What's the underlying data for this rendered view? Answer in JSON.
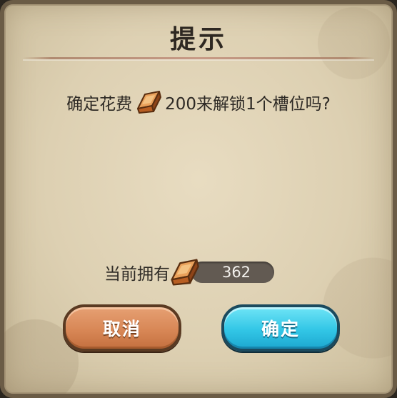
{
  "dialog": {
    "title": "提示",
    "message_prefix": "确定花费",
    "message_suffix": "200来解锁1个槽位吗?",
    "currency_icon": "gold-ingot-icon",
    "owned_label": "当前拥有",
    "owned_value": "362",
    "cancel_label": "取消",
    "confirm_label": "确定"
  },
  "colors": {
    "cancel_button": "#d88756",
    "confirm_button": "#32c6e6",
    "panel_background": "#ddd0b2",
    "value_pill": "#625a52"
  }
}
